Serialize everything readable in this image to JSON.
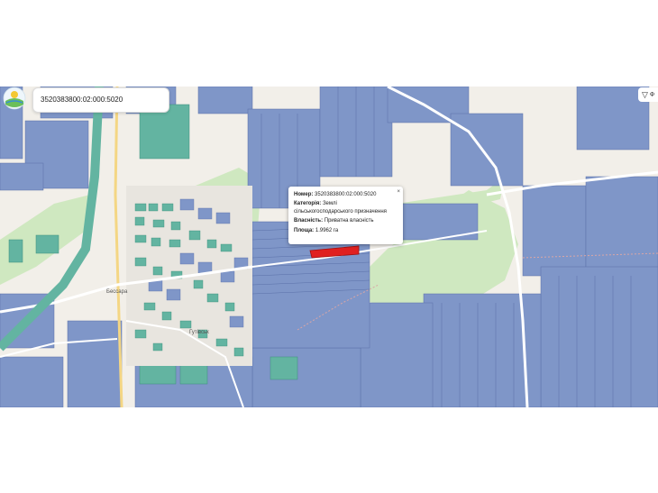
{
  "search": {
    "value": "3520383800:02:000:5020",
    "placeholder": ""
  },
  "filter": {
    "icon": "filter-icon",
    "label": "Ф"
  },
  "popup": {
    "close": "×",
    "number_label": "Номер:",
    "number_value": "3520383800:02:000:5020",
    "category_label": "Категорія:",
    "category_value": "Землі сільськогосподарського призначення",
    "ownership_label": "Власність:",
    "ownership_value": "Приватна власність",
    "area_label": "Площа:",
    "area_value": "1.9962 га"
  },
  "map_labels": {
    "street1": "Бессара",
    "street2": "Гутівськ"
  },
  "colors": {
    "parcel": "#7f96c8",
    "parcel_dark": "#6f87be",
    "green": "#cfe8c0",
    "teal": "#63b4a1",
    "road": "#f4d684",
    "selected": "#e02020"
  }
}
